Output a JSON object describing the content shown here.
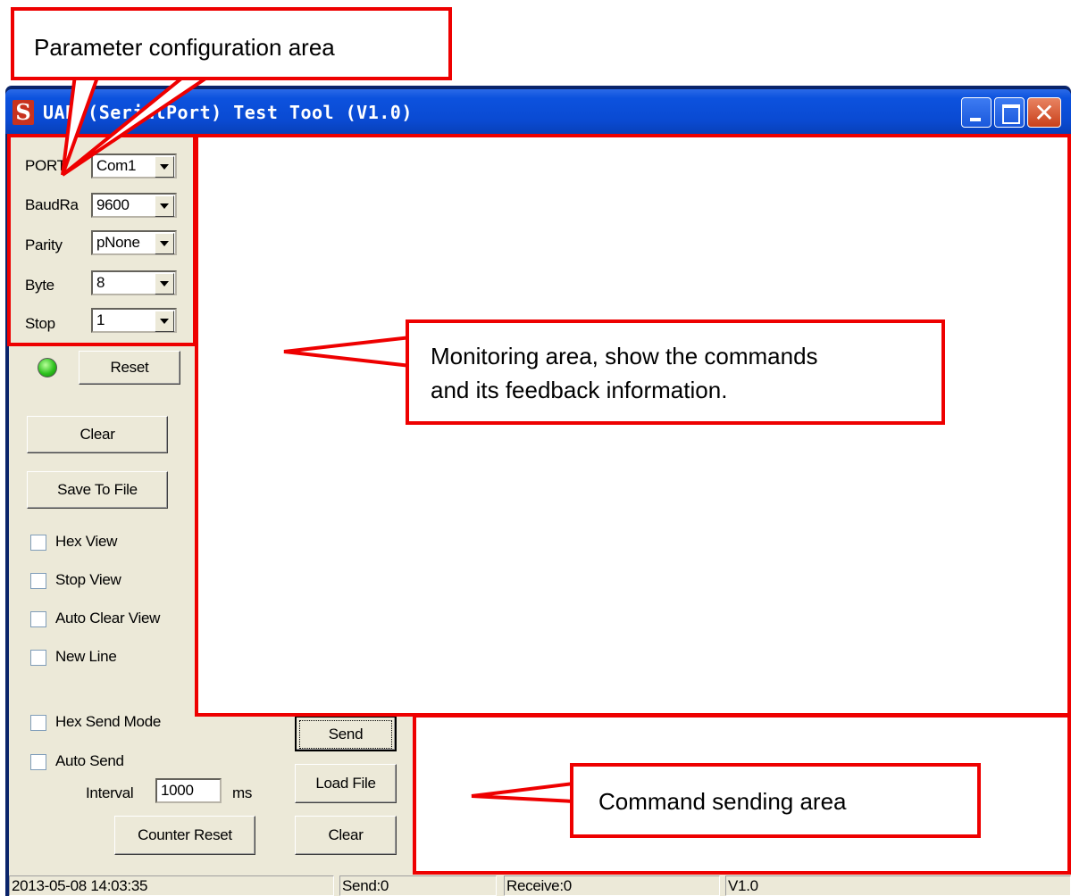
{
  "window": {
    "title": "UART(SerialPort) Test Tool (V1.0)",
    "icon_letter": "S"
  },
  "params": [
    {
      "label": "PORT",
      "value": "Com1"
    },
    {
      "label": "BaudRa",
      "value": "9600"
    },
    {
      "label": "Parity",
      "value": "pNone"
    },
    {
      "label": "Byte",
      "value": "8"
    },
    {
      "label": "Stop",
      "value": "1"
    }
  ],
  "buttons": {
    "reset": "Reset",
    "clear": "Clear",
    "save_to_file": "Save To File",
    "send": "Send",
    "load_file": "Load File",
    "clear_send": "Clear",
    "counter_reset": "Counter Reset"
  },
  "checkboxes": {
    "hex_view": "Hex View",
    "stop_view": "Stop View",
    "auto_clear_view": "Auto Clear View",
    "new_line": "New Line",
    "hex_send_mode": "Hex Send Mode",
    "auto_send": "Auto Send"
  },
  "interval": {
    "label": "Interval",
    "value": "1000",
    "unit": "ms"
  },
  "status": {
    "datetime": "2013-05-08 14:03:35",
    "send": "Send:0",
    "receive": "Receive:0",
    "version": "V1.0"
  },
  "annotations": {
    "param_area": "Parameter configuration area",
    "monitor_line1": "Monitoring area, show the commands",
    "monitor_line2": "and its feedback information.",
    "send_area": "Command sending area"
  },
  "colors": {
    "annotation_red": "#ee0000",
    "led_green": "#2ec21e",
    "titlebar_blue": "#0c52de"
  }
}
